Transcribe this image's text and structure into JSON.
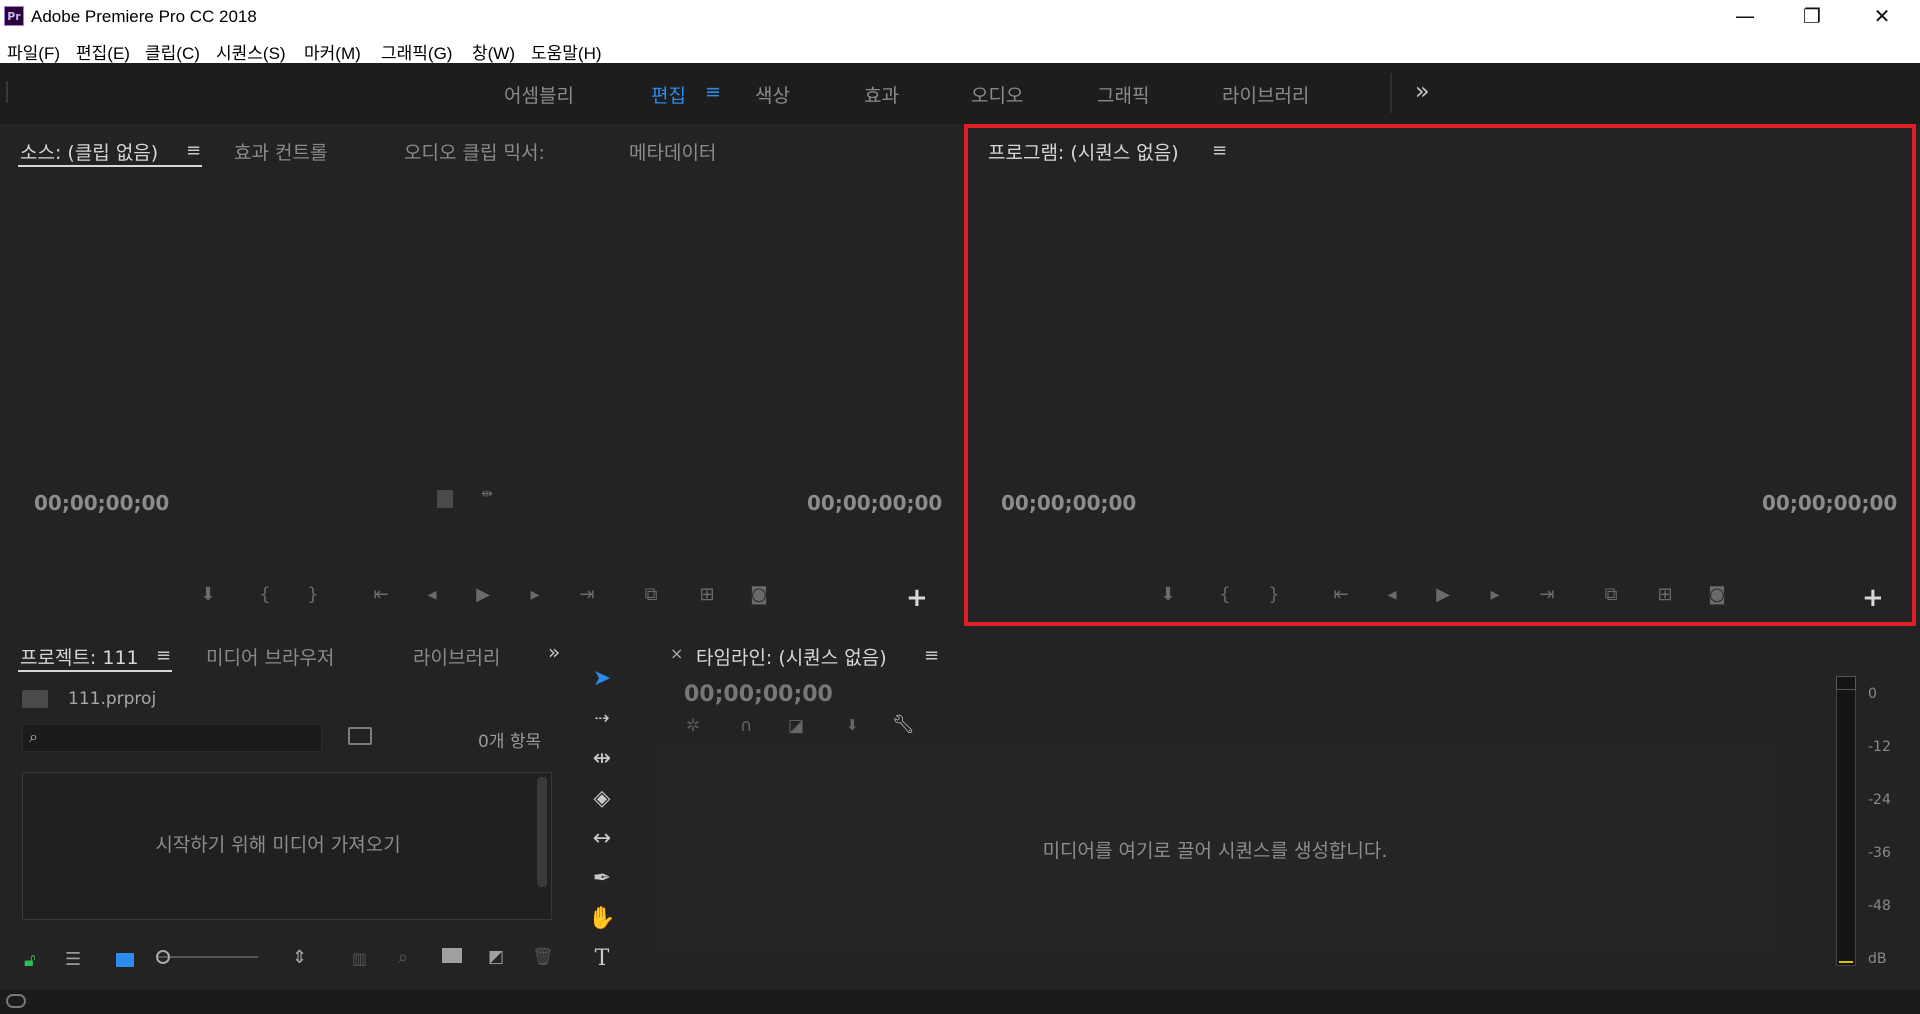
{
  "window": {
    "app_icon": "Pr",
    "title": "Adobe Premiere Pro CC 2018",
    "controls": {
      "minimize": "—",
      "restore": "❐",
      "close": "✕"
    }
  },
  "menubar": {
    "items": [
      "파일(F)",
      "편집(E)",
      "클립(C)",
      "시퀀스(S)",
      "마커(M)",
      "그래픽(G)",
      "창(W)",
      "도움말(H)"
    ]
  },
  "workspaces": {
    "items": [
      "어셈블리",
      "편집",
      "색상",
      "효과",
      "오디오",
      "그래픽",
      "라이브러리"
    ],
    "active": "편집",
    "more": "»",
    "menu_icon": "≡"
  },
  "source_panel": {
    "tabs": [
      "소스: (클립 없음)",
      "효과 컨트롤",
      "오디오 클립 믹서:",
      "메타데이터"
    ],
    "menu_icon": "≡",
    "timecode_left": "00;00;00;00",
    "timecode_right": "00;00;00;00",
    "add": "+"
  },
  "program_panel": {
    "tab": "프로그램: (시퀀스 없음)",
    "menu_icon": "≡",
    "timecode_left": "00;00;00;00",
    "timecode_right": "00;00;00;00",
    "add": "+"
  },
  "project_panel": {
    "tabs": [
      "프로젝트: 111",
      "미디어 브라우저",
      "라이브러리"
    ],
    "menu_icon": "≡",
    "more": "»",
    "file_name": "111.prproj",
    "search_placeholder": "",
    "item_count": "0개 항목",
    "empty_message": "시작하기 위해 미디어 가져오기"
  },
  "timeline_panel": {
    "close": "×",
    "tab": "타임라인: (시퀀스 없음)",
    "menu_icon": "≡",
    "timecode": "00;00;00;00",
    "empty_message": "미디어를 여기로 끌어 시퀀스를 생성합니다."
  },
  "audio_meter": {
    "labels": [
      "0",
      "-12",
      "-24",
      "-36",
      "-48",
      "dB"
    ]
  },
  "colors": {
    "accent": "#2d8ceb",
    "highlight": "#e01e26",
    "panel_bg": "#232323",
    "bar_bg": "#1d1d1d"
  }
}
